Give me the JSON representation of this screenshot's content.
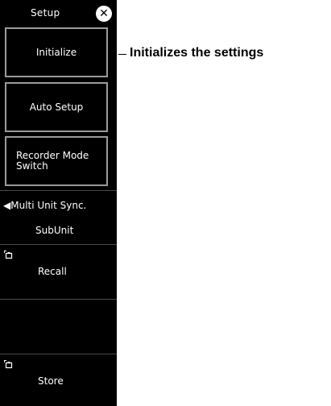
{
  "panel": {
    "title": "Setup",
    "close_symbol": "✕",
    "buttons": {
      "initialize": "Initialize",
      "auto_setup": "Auto Setup",
      "recorder_mode_line1": "Recorder Mode",
      "recorder_mode_line2": "Switch"
    },
    "multi_unit_sync": {
      "label": "◀Multi Unit Sync.",
      "value": "SubUnit"
    },
    "recall_label": "Recall",
    "store_label": "Store"
  },
  "callout": {
    "text": "Initializes the settings"
  },
  "colors": {
    "panel_bg": "#000000",
    "button_border": "#9a9a9a",
    "text": "#ffffff"
  },
  "icons": [
    "close-icon",
    "recall-file-icon",
    "store-file-icon"
  ]
}
